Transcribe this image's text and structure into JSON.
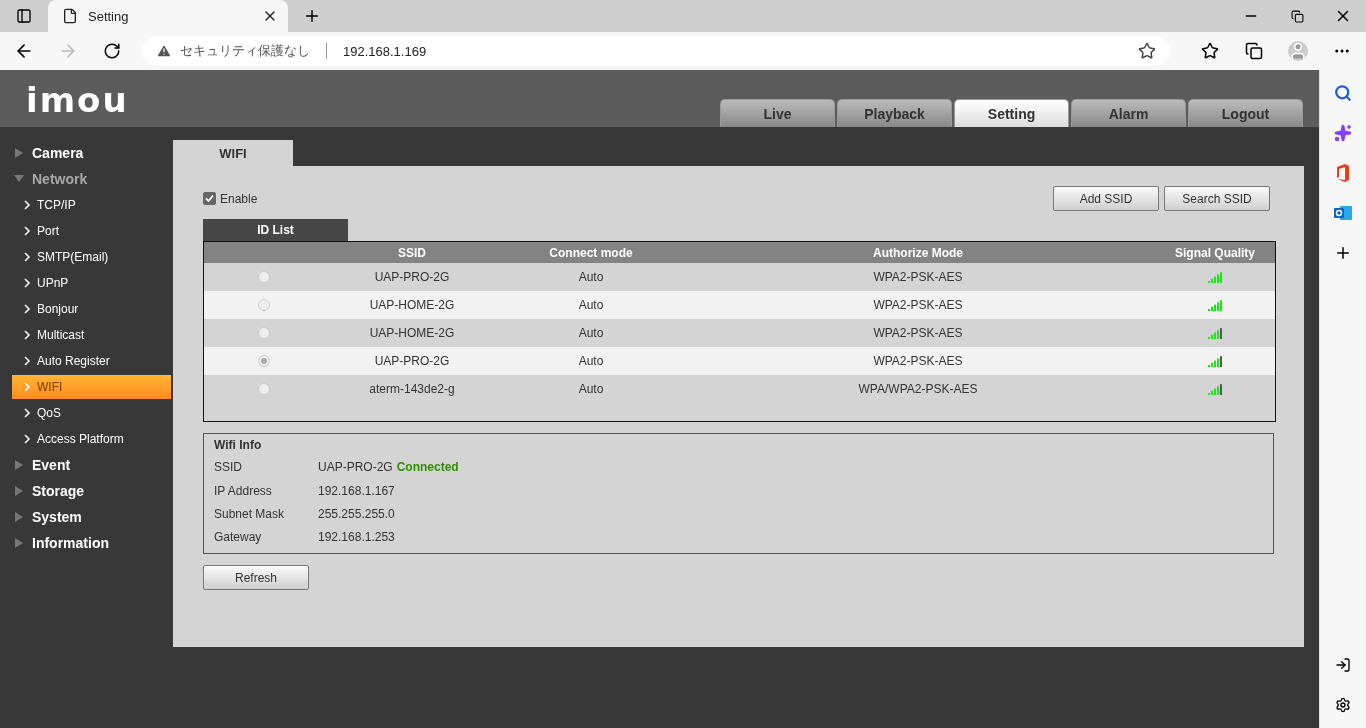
{
  "browser": {
    "tab_title": "Setting",
    "security_label": "セキュリティ保護なし",
    "address": "192.168.1.169"
  },
  "logo": "imou",
  "top_tabs": [
    {
      "label": "Live",
      "selected": false
    },
    {
      "label": "Playback",
      "selected": false
    },
    {
      "label": "Setting",
      "selected": true
    },
    {
      "label": "Alarm",
      "selected": false
    },
    {
      "label": "Logout",
      "selected": false
    }
  ],
  "sidebar": {
    "items": [
      {
        "label": "Camera",
        "expanded": false
      },
      {
        "label": "Network",
        "expanded": true,
        "children": [
          {
            "label": "TCP/IP",
            "selected": false
          },
          {
            "label": "Port",
            "selected": false
          },
          {
            "label": "SMTP(Email)",
            "selected": false
          },
          {
            "label": "UPnP",
            "selected": false
          },
          {
            "label": "Bonjour",
            "selected": false
          },
          {
            "label": "Multicast",
            "selected": false
          },
          {
            "label": "Auto Register",
            "selected": false
          },
          {
            "label": "WIFI",
            "selected": true
          },
          {
            "label": "QoS",
            "selected": false
          },
          {
            "label": "Access Platform",
            "selected": false
          }
        ]
      },
      {
        "label": "Event",
        "expanded": false
      },
      {
        "label": "Storage",
        "expanded": false
      },
      {
        "label": "System",
        "expanded": false
      },
      {
        "label": "Information",
        "expanded": false
      }
    ]
  },
  "page_tab": "WIFI",
  "enable": {
    "label": "Enable",
    "checked": true
  },
  "buttons": [
    "Add SSID",
    "Search SSID"
  ],
  "list_tab": "ID List",
  "table": {
    "columns": [
      "SSID",
      "Connect mode",
      "Authorize Mode",
      "Signal Quality"
    ],
    "rows": [
      {
        "selected": false,
        "ssid": "UAP-PRO-2G",
        "connect_mode": "Auto",
        "authorize_mode": "WPA2-PSK-AES",
        "full_signal": true
      },
      {
        "selected": false,
        "ssid": "UAP-HOME-2G",
        "connect_mode": "Auto",
        "authorize_mode": "WPA2-PSK-AES",
        "full_signal": true
      },
      {
        "selected": false,
        "ssid": "UAP-HOME-2G",
        "connect_mode": "Auto",
        "authorize_mode": "WPA2-PSK-AES",
        "full_signal": false
      },
      {
        "selected": true,
        "ssid": "UAP-PRO-2G",
        "connect_mode": "Auto",
        "authorize_mode": "WPA2-PSK-AES",
        "full_signal": false
      },
      {
        "selected": false,
        "ssid": "aterm-143de2-g",
        "connect_mode": "Auto",
        "authorize_mode": "WPA/WPA2-PSK-AES",
        "full_signal": false
      }
    ]
  },
  "wifi_info": {
    "title": "Wifi Info",
    "fields": [
      {
        "label": "SSID",
        "value": "UAP-PRO-2G",
        "status": "Connected"
      },
      {
        "label": "IP Address",
        "value": "192.168.1.167"
      },
      {
        "label": "Subnet Mask",
        "value": "255.255.255.0"
      },
      {
        "label": "Gateway",
        "value": "192.168.1.253"
      }
    ]
  },
  "refresh_button": "Refresh"
}
